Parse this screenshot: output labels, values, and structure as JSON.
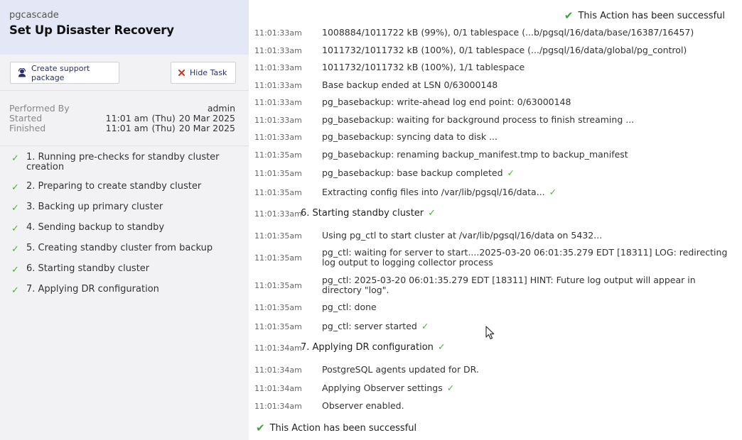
{
  "header": {
    "app_name": "pgcascade",
    "title": "Set Up Disaster Recovery"
  },
  "buttons": {
    "support": "Create support package",
    "hide": "Hide Task"
  },
  "meta": {
    "performed_by_label": "Performed By",
    "performed_by": "admin",
    "started_label": "Started",
    "started_time": "11:01 am",
    "started_day": "(Thu)",
    "started_date": "20 Mar 2025",
    "finished_label": "Finished",
    "finished_time": "11:01 am",
    "finished_day": "(Thu)",
    "finished_date": "20 Mar 2025"
  },
  "steps": [
    {
      "label": "1. Running pre-checks for standby cluster creation",
      "status": "done"
    },
    {
      "label": "2. Preparing to create standby cluster",
      "status": "done"
    },
    {
      "label": "3. Backing up primary cluster",
      "status": "done"
    },
    {
      "label": "4. Sending backup to standby",
      "status": "done"
    },
    {
      "label": "5. Creating standby cluster from backup",
      "status": "done"
    },
    {
      "label": "6. Starting standby cluster",
      "status": "done"
    },
    {
      "label": "7. Applying DR configuration",
      "status": "done"
    }
  ],
  "status_messages": {
    "top": "This Action has been successful",
    "bottom": "This Action has been successful"
  },
  "log": [
    {
      "time": "11:01:33am",
      "text": "1008884/1011722 kB (99%), 0/1 tablespace (...b/pgsql/16/data/base/16387/16457)"
    },
    {
      "time": "11:01:33am",
      "text": "1011732/1011732 kB (100%), 0/1 tablespace (.../pgsql/16/data/global/pg_control)"
    },
    {
      "time": "11:01:33am",
      "text": "1011732/1011732 kB (100%), 1/1 tablespace"
    },
    {
      "time": "11:01:33am",
      "text": "Base backup ended at LSN 0/63000148"
    },
    {
      "time": "11:01:33am",
      "text": "pg_basebackup: write-ahead log end point: 0/63000148"
    },
    {
      "time": "11:01:33am",
      "text": "pg_basebackup: waiting for background process to finish streaming ..."
    },
    {
      "time": "11:01:33am",
      "text": "pg_basebackup: syncing data to disk ..."
    },
    {
      "time": "11:01:35am",
      "text": "pg_basebackup: renaming backup_manifest.tmp to backup_manifest"
    },
    {
      "time": "11:01:35am",
      "text": "pg_basebackup: base backup completed",
      "ok": true
    },
    {
      "time": "11:01:35am",
      "text": "Extracting config files into /var/lib/pgsql/16/data...",
      "ok": true
    },
    {
      "time": "11:01:33am",
      "text": "6. Starting standby cluster",
      "ok": true,
      "section": true
    },
    {
      "time": "11:01:35am",
      "text": "Using pg_ctl to start cluster at /var/lib/pgsql/16/data on 5432..."
    },
    {
      "time": "11:01:35am",
      "text": "pg_ctl: waiting for server to start....2025-03-20 06:01:35.279 EDT [18311] LOG: redirecting log output to logging collector process"
    },
    {
      "time": "11:01:35am",
      "text": "pg_ctl: 2025-03-20 06:01:35.279 EDT [18311] HINT: Future log output will appear in directory \"log\"."
    },
    {
      "time": "11:01:35am",
      "text": "pg_ctl: done"
    },
    {
      "time": "11:01:35am",
      "text": "pg_ctl: server started",
      "ok": true
    },
    {
      "time": "11:01:34am",
      "text": "7. Applying DR configuration",
      "ok": true,
      "section": true
    },
    {
      "time": "11:01:34am",
      "text": "PostgreSQL agents updated for DR."
    },
    {
      "time": "11:01:34am",
      "text": "Applying Observer settings",
      "ok": true
    },
    {
      "time": "11:01:34am",
      "text": "Observer enabled."
    }
  ],
  "icons": {
    "check": "check-icon",
    "support": "support-agent-icon",
    "close": "close-icon",
    "cursor": "mouse-pointer-icon"
  },
  "colors": {
    "accent": "#2b2f6b",
    "success": "#4fae3a",
    "danger": "#c0392b",
    "header_bg": "#e4e7f5",
    "panel_bg": "#f2f2f4"
  }
}
